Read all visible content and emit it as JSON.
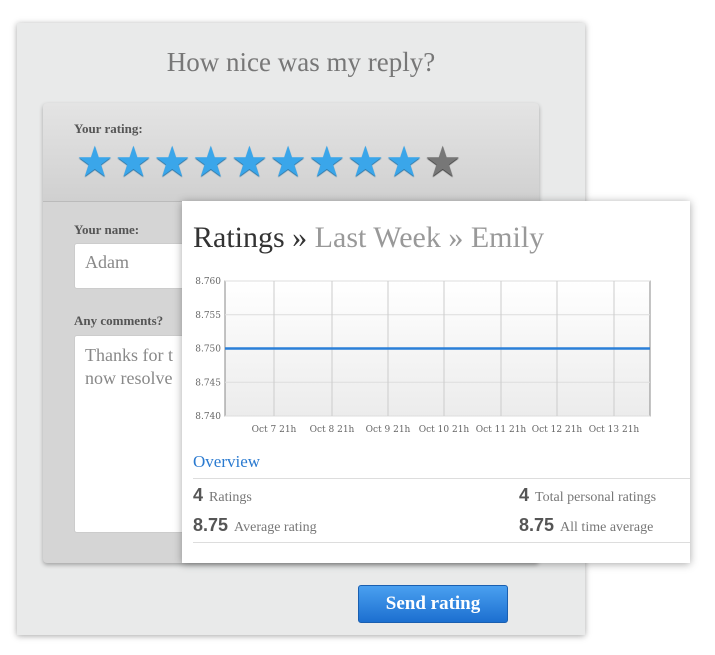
{
  "form": {
    "title": "How nice was my reply?",
    "rating_label": "Your rating:",
    "rating": {
      "value": 9,
      "max": 10
    },
    "name_label": "Your name:",
    "name_value": "Adam",
    "comments_label": "Any comments?",
    "comments_value": "Thanks for t\nnow resolve",
    "send_label": "Send rating"
  },
  "card": {
    "breadcrumb": [
      "Ratings",
      "»",
      "Last Week",
      "»",
      "Emily"
    ],
    "overview_label": "Overview",
    "stats": [
      {
        "value": "4",
        "label": "Ratings"
      },
      {
        "value": "4",
        "label": "Total personal ratings"
      },
      {
        "value": "8.75",
        "label": "Average rating"
      },
      {
        "value": "8.75",
        "label": "All time average"
      }
    ]
  },
  "chart_data": {
    "type": "line",
    "x": [
      "Oct 7 21h",
      "Oct 8 21h",
      "Oct 9 21h",
      "Oct 10 21h",
      "Oct 11 21h",
      "Oct 12 21h",
      "Oct 13 21h"
    ],
    "y_ticks": [
      "8.740",
      "8.745",
      "8.750",
      "8.755",
      "8.760"
    ],
    "ylim": [
      8.74,
      8.76
    ],
    "series": [
      {
        "values": [
          8.75,
          8.75,
          8.75,
          8.75,
          8.75,
          8.75,
          8.75,
          8.75,
          8.75
        ]
      }
    ],
    "grid": true,
    "color": "#2a7fd8"
  }
}
